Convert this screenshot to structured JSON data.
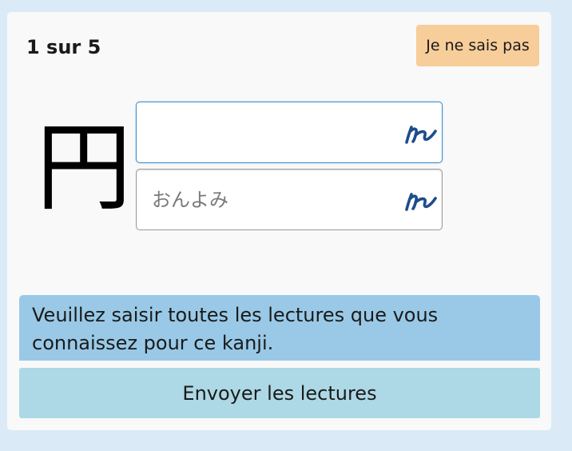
{
  "quiz": {
    "progress": "1 sur 5",
    "skip_label": "Je ne sais pas",
    "kanji": "円"
  },
  "fields": {
    "kunyomi": {
      "value": "",
      "placeholder": ""
    },
    "onyomi": {
      "value": "",
      "placeholder": "おんよみ"
    }
  },
  "icons": {
    "ime": "japanese-input-icon"
  },
  "message": {
    "text": "Veuillez saisir toutes les lectures que vous connaissez pour ce kanji."
  },
  "actions": {
    "submit_label": "Envoyer les lectures"
  },
  "colors": {
    "page_bg": "#daeaf7",
    "card_bg": "#f9f9f9",
    "skip_bg": "#f7cd9a",
    "message_bg": "#99c9e6",
    "submit_bg": "#add8e6",
    "icon_color": "#1d4c8c",
    "focus_border": "#3d8fd1"
  }
}
